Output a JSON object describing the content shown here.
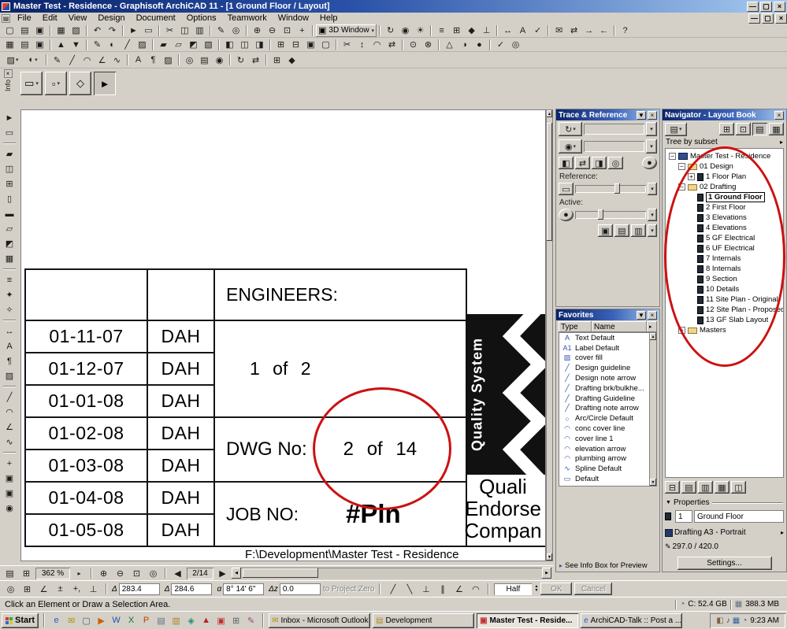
{
  "chrome": {
    "minimize": "—",
    "maximize": "▢",
    "close": "×",
    "panel_menu": "▼",
    "panel_arrow": "▸"
  },
  "titlebar": {
    "title": "Master Test - Residence - Graphisoft ArchiCAD 11 - [1 Ground Floor / Layout]"
  },
  "menubar": {
    "items": [
      "File",
      "Edit",
      "View",
      "Design",
      "Document",
      "Options",
      "Teamwork",
      "Window",
      "Help"
    ]
  },
  "toolbar1": {
    "items": [
      "new",
      "open",
      "save",
      "sep",
      "print",
      "plot",
      "sep",
      "undo",
      "redo",
      "sep",
      "pointer",
      "marquee",
      "sep",
      "cut",
      "copy",
      "paste",
      "sep",
      "pen",
      "find",
      "sep",
      "zoom-in",
      "zoom-out",
      "fit",
      "pan",
      "sep",
      "combo:3D Window",
      "sep",
      "orbit",
      "camera",
      "sun",
      "sep",
      "layers",
      "grid",
      "magnet",
      "gravity",
      "sep",
      "dimension",
      "text",
      "check",
      "sep",
      "mail",
      "organizer",
      "send",
      "receive",
      "sep",
      "help"
    ]
  },
  "toolbar2": {
    "items": [
      "table",
      "layout-book",
      "drawing2",
      "sep",
      "story-up",
      "story-down",
      "sep",
      "pen-set",
      "color",
      "linetype",
      "fill",
      "sep",
      "wall2",
      "slab2",
      "roof2",
      "mesh2",
      "sep",
      "align-l",
      "align-c",
      "align-r",
      "sep",
      "front",
      "back",
      "group",
      "ungroup",
      "sep",
      "split",
      "adjust",
      "fillet",
      "resize",
      "sep",
      "hotlink",
      "xref",
      "sep",
      "north",
      "shadow",
      "render",
      "sep",
      "spell",
      "find2"
    ]
  },
  "toolbar3": {
    "items": [
      "dd:fill",
      "dd:color",
      "sep",
      "pencil",
      "line",
      "arc",
      "polyline",
      "spline",
      "sep",
      "text",
      "label",
      "fill",
      "sep",
      "detail",
      "worksheet",
      "camera",
      "sep",
      "update",
      "organizer",
      "sep",
      "grid",
      "magnet"
    ]
  },
  "infobox": {
    "tab": "Info",
    "buttons": [
      "dd:marquee",
      "dd:marquee2",
      "diamond",
      "pointer2"
    ]
  },
  "left_toolbar": {
    "items": [
      "pointer",
      "marquee",
      "sep",
      "wall",
      "door",
      "window",
      "column",
      "beam",
      "slab",
      "roof",
      "mesh",
      "sep",
      "stair",
      "object",
      "lamp",
      "sep",
      "dimension",
      "text",
      "label",
      "fill",
      "sep",
      "line",
      "arc",
      "polyline",
      "spline",
      "sep",
      "hotspot",
      "figure",
      "drawing2",
      "camera"
    ]
  },
  "canvas": {
    "revisions": [
      {
        "date": "01-11-07",
        "by": "DAH"
      },
      {
        "date": "01-12-07",
        "by": "DAH"
      },
      {
        "date": "01-01-08",
        "by": "DAH"
      },
      {
        "date": "01-02-08",
        "by": "DAH"
      },
      {
        "date": "01-03-08",
        "by": "DAH"
      },
      {
        "date": "01-04-08",
        "by": "DAH"
      },
      {
        "date": "01-05-08",
        "by": "DAH"
      }
    ],
    "engineers_label": "ENGINEERS:",
    "sheet_of": "1 of 2",
    "dwg_label": "DWG No:",
    "dwg_value": "2 of 14",
    "job_label": "JOB NO:",
    "job_value": "#Pln",
    "quality_banner": "Quality System",
    "company_lines": [
      "Quali",
      "Endorse",
      "Compan"
    ],
    "footer_path": "F:\\Development\\Master Test - Residence"
  },
  "trace_panel": {
    "title": "Trace & Reference",
    "reference_label": "Reference:",
    "active_label": "Active:"
  },
  "favorites_panel": {
    "title": "Favorites",
    "col_type": "Type",
    "col_name": "Name",
    "items": [
      {
        "icon": "text-icon",
        "label": "Text Default"
      },
      {
        "icon": "label-icon",
        "label": "Label Default"
      },
      {
        "icon": "fill-icon",
        "label": "cover fill"
      },
      {
        "icon": "line-icon",
        "label": "Design guideline"
      },
      {
        "icon": "line-icon",
        "label": "Design note arrow"
      },
      {
        "icon": "line-icon",
        "label": "Drafting brk/bulkhe..."
      },
      {
        "icon": "line-icon",
        "label": "Drafting Guideline"
      },
      {
        "icon": "line-icon",
        "label": "Drafting note arrow"
      },
      {
        "icon": "circle-icon",
        "label": "Arc/Circle Default"
      },
      {
        "icon": "arc-icon",
        "label": "conc cover line"
      },
      {
        "icon": "arc-icon",
        "label": "cover line 1"
      },
      {
        "icon": "arc-icon",
        "label": "elevation arrow"
      },
      {
        "icon": "arc-icon",
        "label": "plumbing arrow"
      },
      {
        "icon": "spline-icon",
        "label": "Spline Default"
      },
      {
        "icon": "default-icon",
        "label": "Default"
      }
    ],
    "footer": "See Info Box for Preview"
  },
  "navigator_panel": {
    "title": "Navigator - Layout Book",
    "subset_label": "Tree by subset",
    "tree": [
      {
        "label": "Master Test - Residence",
        "level": 0,
        "exp": "minus",
        "icon": "book"
      },
      {
        "label": "01 Design",
        "level": 1,
        "exp": "minus",
        "icon": "folder"
      },
      {
        "label": "1 Floor Plan",
        "level": 2,
        "exp": "plus",
        "icon": "layout"
      },
      {
        "label": "02 Drafting",
        "level": 1,
        "exp": "minus",
        "icon": "folder"
      },
      {
        "label": "1 Ground Floor",
        "level": 2,
        "exp": "none",
        "icon": "layout",
        "selected": true
      },
      {
        "label": "2 First Floor",
        "level": 2,
        "exp": "none",
        "icon": "layout"
      },
      {
        "label": "3 Elevations",
        "level": 2,
        "exp": "none",
        "icon": "layout"
      },
      {
        "label": "4 Elevations",
        "level": 2,
        "exp": "none",
        "icon": "layout"
      },
      {
        "label": "5 GF Electrical",
        "level": 2,
        "exp": "none",
        "icon": "layout"
      },
      {
        "label": "6 UF Electrical",
        "level": 2,
        "exp": "none",
        "icon": "layout"
      },
      {
        "label": "7 Internals",
        "level": 2,
        "exp": "none",
        "icon": "layout"
      },
      {
        "label": "8 Internals",
        "level": 2,
        "exp": "none",
        "icon": "layout"
      },
      {
        "label": "9 Section",
        "level": 2,
        "exp": "none",
        "icon": "layout"
      },
      {
        "label": "10 Details",
        "level": 2,
        "exp": "none",
        "icon": "layout"
      },
      {
        "label": "11 Site Plan - Original",
        "level": 2,
        "exp": "none",
        "icon": "layout"
      },
      {
        "label": "12 Site Plan - Proposed",
        "level": 2,
        "exp": "none",
        "icon": "layout"
      },
      {
        "label": "13 GF Slab Layout",
        "level": 2,
        "exp": "none",
        "icon": "layout"
      },
      {
        "label": "Masters",
        "level": 1,
        "exp": "plus",
        "icon": "folder"
      }
    ],
    "properties": {
      "header": "Properties",
      "id": "1",
      "name": "Ground Floor",
      "master": "Drafting A3 - Portrait",
      "size": "297.0 / 420.0",
      "settings": "Settings..."
    }
  },
  "bottom_bar": {
    "zoom": "362 %",
    "pager": "2/14"
  },
  "coord_bar": {
    "left_icons": [
      "tracker-coord",
      "grid-snap",
      "angle-snap",
      "relative-coords",
      "plus-comma",
      "gravity-toggle"
    ],
    "fields": [
      {
        "label": "Δ",
        "value": "283.4"
      },
      {
        "label": "Δ",
        "value": "284.6"
      },
      {
        "label": "α",
        "value": "8° 14' 6\""
      },
      {
        "label": "Δz",
        "value": "0.0"
      }
    ],
    "hint": "to Project Zero",
    "right_icons": [
      "guide-line-1",
      "guide-line-2",
      "perpendicular",
      "parallel",
      "angle-bisector",
      "offset-tool"
    ],
    "half_label": "Half",
    "ok": "OK",
    "cancel": "Cancel"
  },
  "status_bar": {
    "message": "Click an Element or Draw a Selection Area.",
    "disk": "C: 52.4 GB",
    "memory": "388.3 MB"
  },
  "taskbar": {
    "start": "Start",
    "quick_launch": [
      "ie",
      "outlook",
      "show-desktop",
      "media-player",
      "word",
      "excel",
      "powerpoint",
      "notepad",
      "explorer",
      "msn",
      "acrobat",
      "archicad-app",
      "calc",
      "paint"
    ],
    "tasks": [
      {
        "icon": "outlook",
        "label": "Inbox - Microsoft Outlook",
        "active": false
      },
      {
        "icon": "folder-tb",
        "label": "Development",
        "active": false
      },
      {
        "icon": "archicad-app",
        "label": "Master Test - Reside...",
        "active": true
      },
      {
        "icon": "ie",
        "label": "ArchiCAD-Talk :: Post a ...",
        "active": false
      }
    ],
    "tray": [
      "display-settings",
      "volume",
      "network",
      "scheduler"
    ],
    "time": "9:23 AM"
  }
}
